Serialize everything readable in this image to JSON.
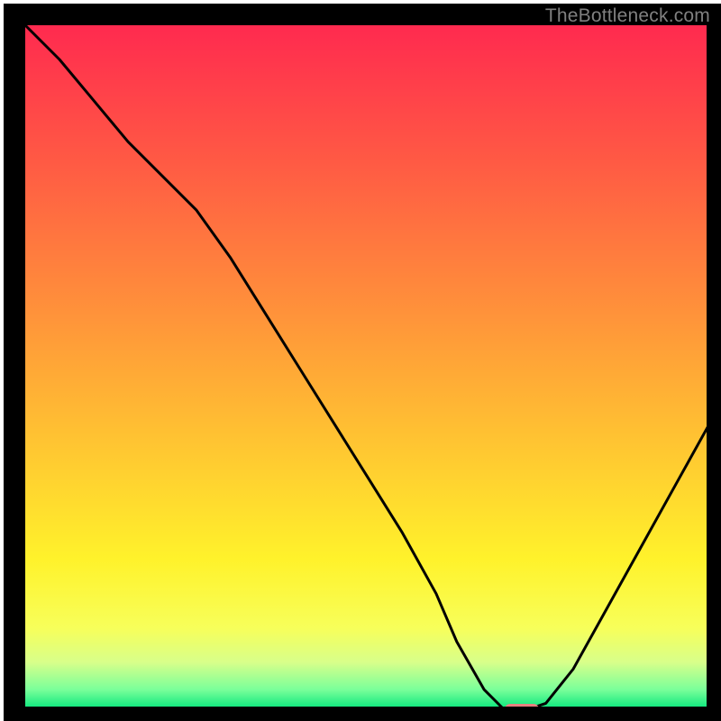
{
  "watermark": "TheBottleneck.com",
  "chart_data": {
    "type": "line",
    "title": "",
    "xlabel": "",
    "ylabel": "",
    "xlim": [
      0,
      100
    ],
    "ylim": [
      0,
      100
    ],
    "x": [
      0,
      5,
      10,
      15,
      20,
      25,
      30,
      35,
      40,
      45,
      50,
      55,
      60,
      63,
      67,
      70,
      73,
      76,
      80,
      85,
      90,
      95,
      100
    ],
    "values": [
      100,
      95,
      89,
      83,
      78,
      73,
      66,
      58,
      50,
      42,
      34,
      26,
      17,
      10,
      3,
      0,
      0,
      1,
      6,
      15,
      24,
      33,
      42
    ],
    "marker": {
      "x_start": 70,
      "x_end": 75,
      "y": 0
    },
    "background": {
      "type": "vertical_gradient",
      "stops": [
        {
          "offset": 0.0,
          "color": "#ff2a4f"
        },
        {
          "offset": 0.2,
          "color": "#ff5a44"
        },
        {
          "offset": 0.4,
          "color": "#ff8d3b"
        },
        {
          "offset": 0.6,
          "color": "#ffc232"
        },
        {
          "offset": 0.78,
          "color": "#fff22b"
        },
        {
          "offset": 0.88,
          "color": "#f7ff5a"
        },
        {
          "offset": 0.93,
          "color": "#d8ff8a"
        },
        {
          "offset": 0.97,
          "color": "#7aff9a"
        },
        {
          "offset": 1.0,
          "color": "#00e57a"
        }
      ]
    },
    "line_color": "#000000",
    "marker_color": "#e88080",
    "frame_color": "#000000"
  }
}
